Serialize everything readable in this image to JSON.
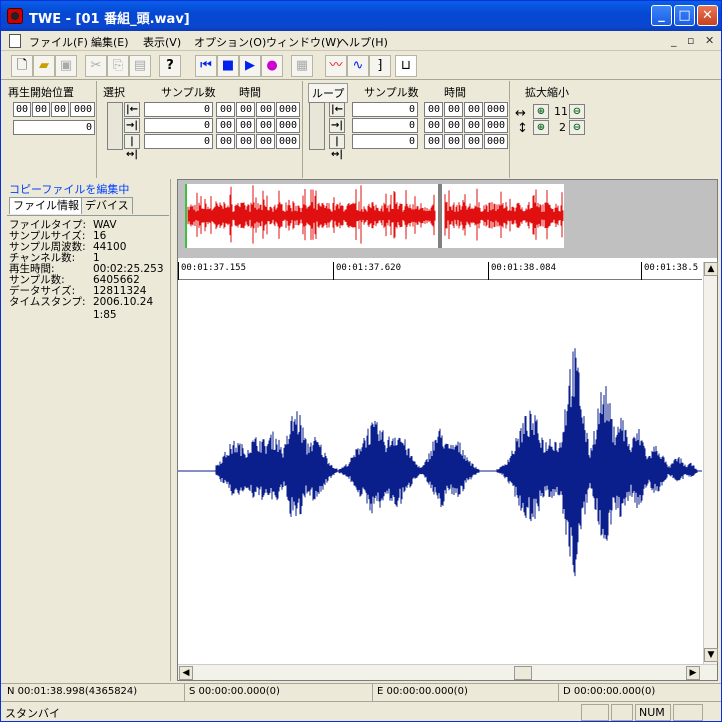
{
  "window": {
    "title": "TWE - [01 番組_頭.wav]"
  },
  "menu": [
    "ファイル(F)",
    "編集(E)",
    "表示(V)",
    "オプション(O)",
    "ウィンドウ(W)",
    "ヘルプ(H)"
  ],
  "play_start": {
    "label": "再生開始位置",
    "time": [
      "00",
      "00",
      "00",
      "000"
    ],
    "samples": "0"
  },
  "selection": {
    "label": "選択",
    "samples_header": "サンプル数",
    "time_header": "時間",
    "rows": [
      {
        "samples": "0",
        "time": [
          "00",
          "00",
          "00",
          "000"
        ]
      },
      {
        "samples": "0",
        "time": [
          "00",
          "00",
          "00",
          "000"
        ]
      },
      {
        "samples": "0",
        "time": [
          "00",
          "00",
          "00",
          "000"
        ]
      }
    ]
  },
  "loop": {
    "label": "ループ",
    "samples_header": "サンプル数",
    "time_header": "時間",
    "rows": [
      {
        "samples": "0",
        "time": [
          "00",
          "00",
          "00",
          "000"
        ]
      },
      {
        "samples": "0",
        "time": [
          "00",
          "00",
          "00",
          "000"
        ]
      },
      {
        "samples": "0",
        "time": [
          "00",
          "00",
          "00",
          "000"
        ]
      }
    ]
  },
  "zoom": {
    "label": "拡大縮小",
    "h_level": "11",
    "v_level": "2"
  },
  "left_panel": {
    "title": "コピーファイルを編集中",
    "tabs": [
      "ファイル情報",
      "デバイス"
    ],
    "info": [
      {
        "key": "ファイルタイプ:",
        "value": "WAV"
      },
      {
        "key": "サンプルサイズ:",
        "value": "16"
      },
      {
        "key": "サンプル周波数:",
        "value": "44100"
      },
      {
        "key": "チャンネル数:",
        "value": "1"
      },
      {
        "key": "再生時間:",
        "value": "00:02:25.253"
      },
      {
        "key": "サンプル数:",
        "value": "6405662"
      },
      {
        "key": "データサイズ:",
        "value": "12811324"
      },
      {
        "key": "タイムスタンプ:",
        "value": "2006.10.24"
      },
      {
        "key": "",
        "value": "1:85"
      }
    ]
  },
  "ruler": [
    "00:01:37.155",
    "00:01:37.620",
    "00:01:38.084",
    "00:01:38.5"
  ],
  "status": {
    "n": "N 00:01:38.998(4365824)",
    "s": "S 00:00:00.000(0)",
    "e": "E 00:00:00.000(0)",
    "d": "D 00:00:00.000(0)",
    "state": "スタンバイ",
    "num": "NUM"
  },
  "colors": {
    "waveform": "#0a1e8c",
    "overview_wave": "#e01010",
    "title_bar": "#0a5fe8"
  }
}
